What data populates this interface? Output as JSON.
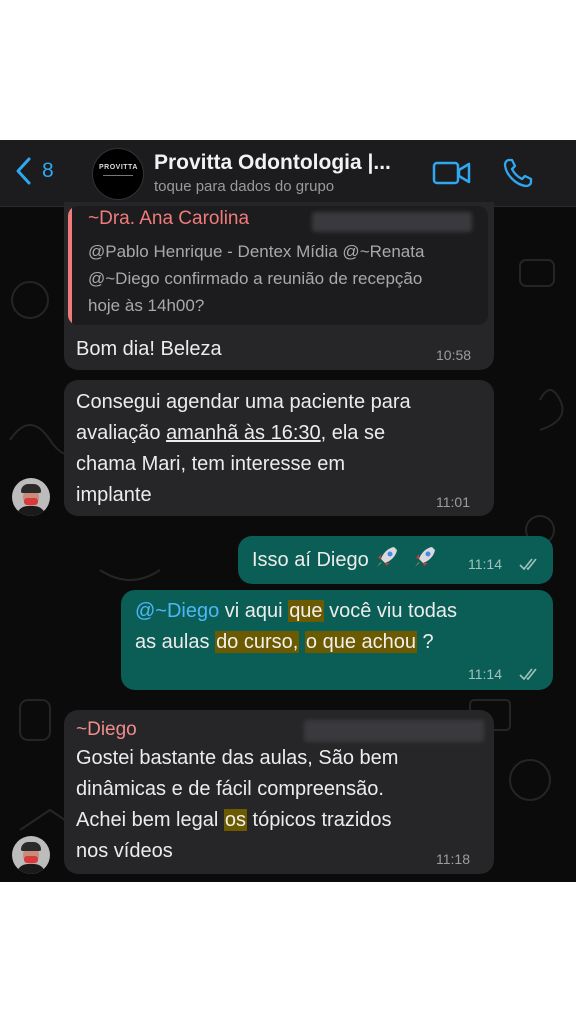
{
  "header": {
    "back_count": "8",
    "avatar_text": "PROVITTA",
    "title": "Provitta Odontologia |...",
    "subtitle": "toque para dados do grupo"
  },
  "messages": [
    {
      "quote_sender": "~Dra. Ana Carolina",
      "quote_line1": "@Pablo Henrique - Dentex Mídia @~Renata",
      "quote_line2": "@~Diego confirmado a reunião de recepção",
      "quote_line3": "hoje às 14h00?",
      "text": "Bom dia! Beleza",
      "time": "10:58"
    },
    {
      "text_line1": "Consegui agendar uma paciente para",
      "text_line2_a": "avaliação ",
      "text_line2_u": "amanhã às 16:30",
      "text_line2_b": ", ela se",
      "text_line3": "chama Mari, tem interesse em",
      "text_line4": "implante",
      "time": "11:01"
    },
    {
      "text": "Isso aí Diego",
      "time": "11:14"
    },
    {
      "mention": "@~Diego",
      "l1_a": " vi aqui ",
      "l1_hl": "que",
      "l1_b": " você viu todas",
      "l2_a": "as aulas ",
      "l2_hl1": "do curso,",
      "l2_b": " ",
      "l2_hl2": "o que achou",
      "l2_c": " ?",
      "time": "11:14"
    },
    {
      "sender": "~Diego",
      "line1": "Gostei bastante das aulas, São bem",
      "line2": "dinâmicas e de fácil compreensão.",
      "line3_a": "Achei bem legal ",
      "line3_hl": "os",
      "line3_b": " tópicos trazidos",
      "line4": "nos vídeos",
      "time": "11:18"
    }
  ],
  "colors": {
    "accent": "#2ea8f0",
    "incoming_bubble": "#262628",
    "outgoing_bubble": "#0b5e55",
    "sender_name": "#f07b7b",
    "highlight": "#6b5a00"
  },
  "icons": [
    "back-chevron-icon",
    "video-call-icon",
    "phone-call-icon",
    "read-ticks-icon",
    "rocket-emoji"
  ]
}
